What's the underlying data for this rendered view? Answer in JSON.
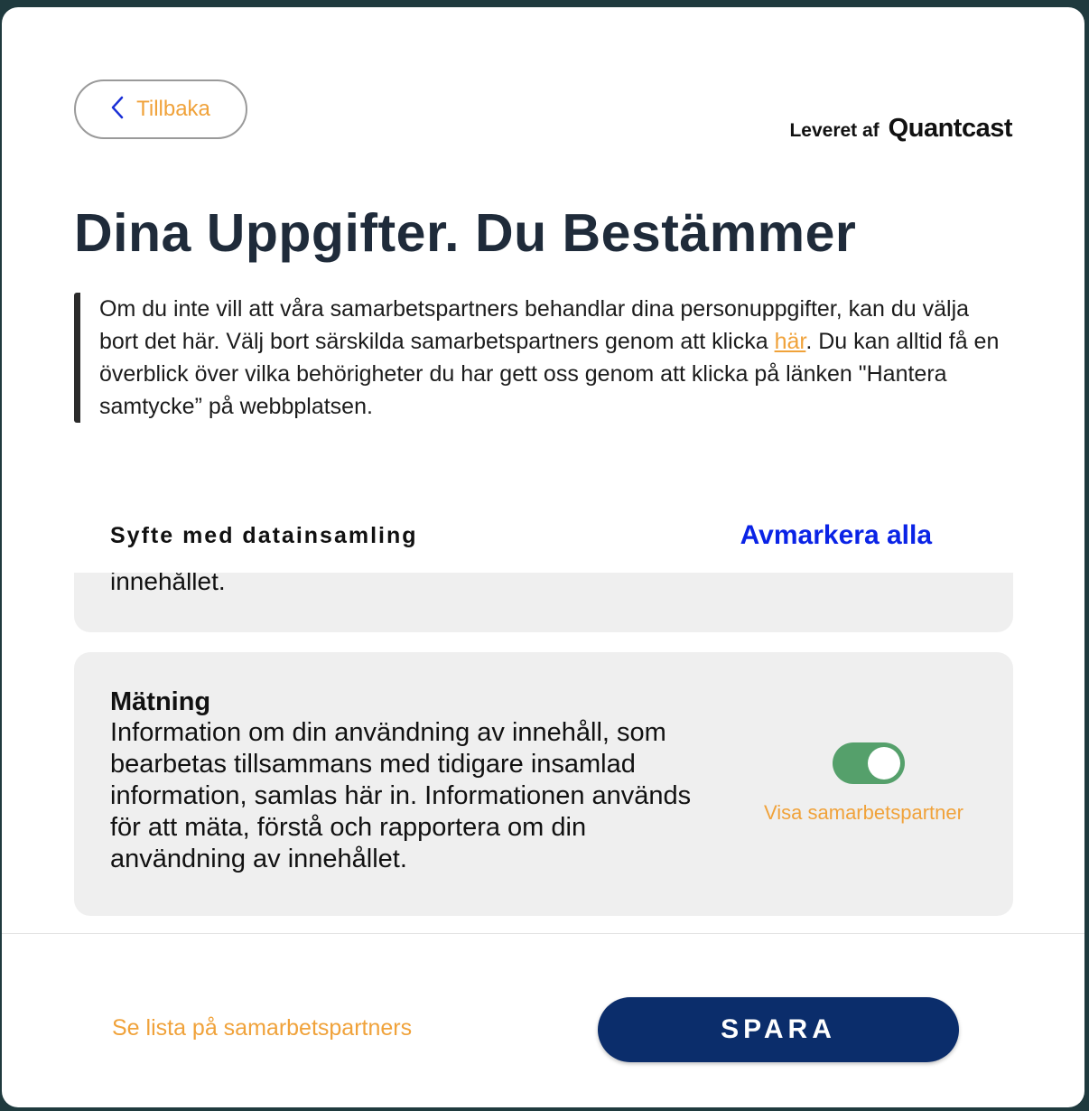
{
  "header": {
    "back_label": "Tillbaka",
    "powered_prefix": "Leveret af",
    "powered_brand": "Quantcast"
  },
  "title": "Dina Uppgifter. Du Bestämmer",
  "description": {
    "before_link": "Om du inte vill att våra samarbetspartners behandlar dina personuppgifter, kan du välja bort det här. Välj bort särskilda samarbetspartners genom att klicka ",
    "link": "här",
    "after_link": ". Du kan alltid få en överblick över vilka behörigheter du har gett oss genom att klicka på länken \"Hantera samtycke” på webbplatsen."
  },
  "purposes": {
    "section_title": "Syfte med datainsamling",
    "deselect_all": "Avmarkera alla",
    "previous_tail": "innehållet.",
    "items": [
      {
        "title": "Mätning",
        "text": "Information om din användning av innehåll, som bearbetas tillsammans med tidigare insamlad information, samlas här in. Informationen används för att mäta, förstå och rapportera om din användning av innehållet.",
        "enabled": true,
        "vendors_link": "Visa samarbetspartner"
      }
    ]
  },
  "footer": {
    "partner_list": "Se lista på samarbetspartners",
    "save_label": "SPARA"
  },
  "colors": {
    "accent_orange": "#f0a23a",
    "primary_navy": "#0b2d6b",
    "link_blue": "#0a23e6",
    "toggle_on": "#55a06b"
  }
}
